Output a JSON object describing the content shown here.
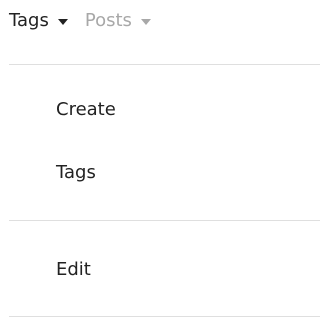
{
  "nav": {
    "tabs": [
      {
        "label": "Tags",
        "active": true
      },
      {
        "label": "Posts",
        "active": false
      }
    ]
  },
  "menu": {
    "items": [
      {
        "label": "Create"
      },
      {
        "label": "Tags"
      },
      {
        "label": "Edit"
      }
    ]
  },
  "colors": {
    "active_text": "#222222",
    "inactive_text": "#a8a8a8",
    "divider": "#dfdfdf",
    "background": "#ffffff"
  }
}
